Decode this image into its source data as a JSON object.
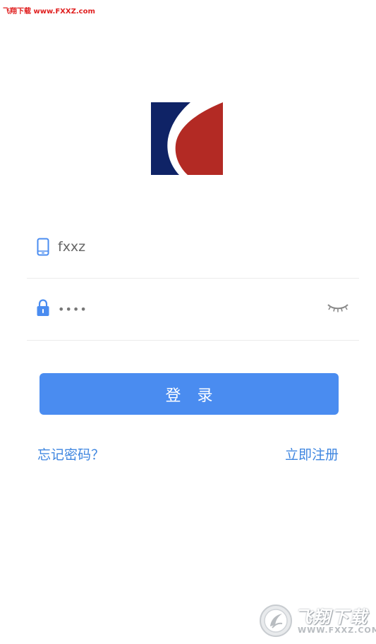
{
  "watermark": {
    "top_text": "飞翔下载 www.FXXZ.com",
    "brand": "飞翔下载",
    "url": "WWW.FXXZ.COM"
  },
  "login": {
    "username_value": "fxxz",
    "password_mask": "••••",
    "submit_label": "登 录",
    "forgot_label": "忘记密码？",
    "register_label": "立即注册"
  },
  "colors": {
    "primary": "#4a8cf0",
    "link": "#3f86e0",
    "logo_navy": "#0f2366",
    "logo_red": "#b32a24",
    "watermark_red": "#e02020"
  },
  "icons": {
    "phone": "phone-icon",
    "lock": "lock-icon",
    "eye": "eye-closed-icon",
    "logo": "app-logo",
    "emblem": "fxxz-emblem-icon"
  }
}
